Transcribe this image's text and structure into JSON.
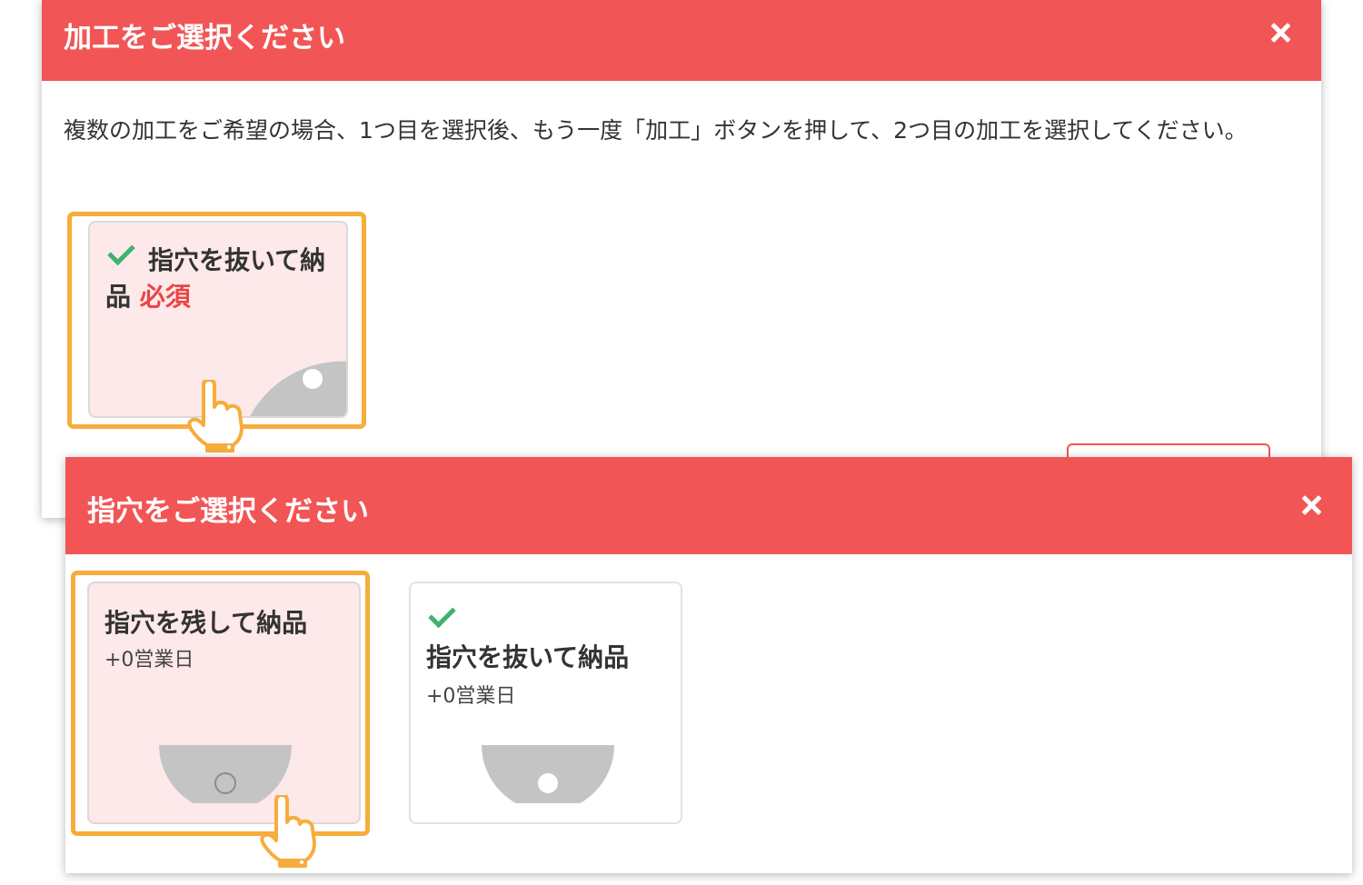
{
  "dialog1": {
    "title": "加工をご選択ください",
    "close_icon": "close-icon",
    "description": "複数の加工をご希望の場合、1つ目を選択後、もう一度「加工」ボタンを押して、2つ目の加工を選択してください。",
    "option": {
      "label_line1": "指穴を抜いて納",
      "label_line2": "品",
      "required": "必須",
      "selected": true
    }
  },
  "dialog2": {
    "title": "指穴をご選択ください",
    "close_icon": "close-icon",
    "options": [
      {
        "label": "指穴を残して納品",
        "sub": "+0営業日",
        "selected": false,
        "highlighted": true
      },
      {
        "label": "指穴を抜いて納品",
        "sub": "+0営業日",
        "selected": true,
        "highlighted": false
      }
    ]
  },
  "colors": {
    "header": "#f25555",
    "highlight": "#f6ad3b",
    "check": "#3db46d",
    "selected_card_bg": "#fde8ea",
    "required": "#e94545"
  }
}
